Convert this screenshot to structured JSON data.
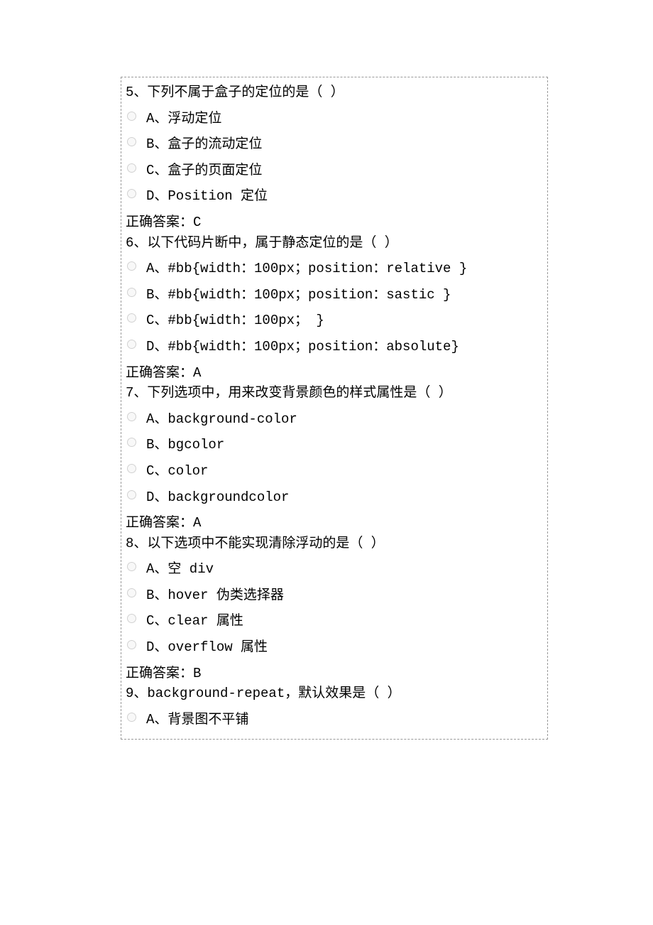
{
  "answer_label_prefix": "正确答案：",
  "questions": [
    {
      "number": "5、",
      "stem": "下列不属于盒子的定位的是（ ）",
      "options": [
        "A、浮动定位",
        "B、盒子的流动定位",
        "C、盒子的页面定位",
        "D、Position 定位"
      ],
      "answer": "C"
    },
    {
      "number": "6、",
      "stem": "以下代码片断中，属于静态定位的是（ ）",
      "options": [
        "A、#bb{width：100px；position：relative }",
        "B、#bb{width：100px；position：sastic }",
        "C、#bb{width：100px； }",
        "D、#bb{width：100px；position：absolute}"
      ],
      "answer": "A"
    },
    {
      "number": "7、",
      "stem": "下列选项中，用来改变背景颜色的样式属性是（ ）",
      "options": [
        "A、background-color",
        "B、bgcolor",
        "C、color",
        "D、backgroundcolor"
      ],
      "answer": "A"
    },
    {
      "number": "8、",
      "stem": "以下选项中不能实现清除浮动的是（ ）",
      "options": [
        "A、空 div",
        "B、hover 伪类选择器",
        "C、clear 属性",
        "D、overflow 属性"
      ],
      "answer": "B"
    },
    {
      "number": "9、",
      "stem": "background-repeat，默认效果是（ ）",
      "options": [
        "A、背景图不平铺"
      ],
      "answer": null
    }
  ]
}
